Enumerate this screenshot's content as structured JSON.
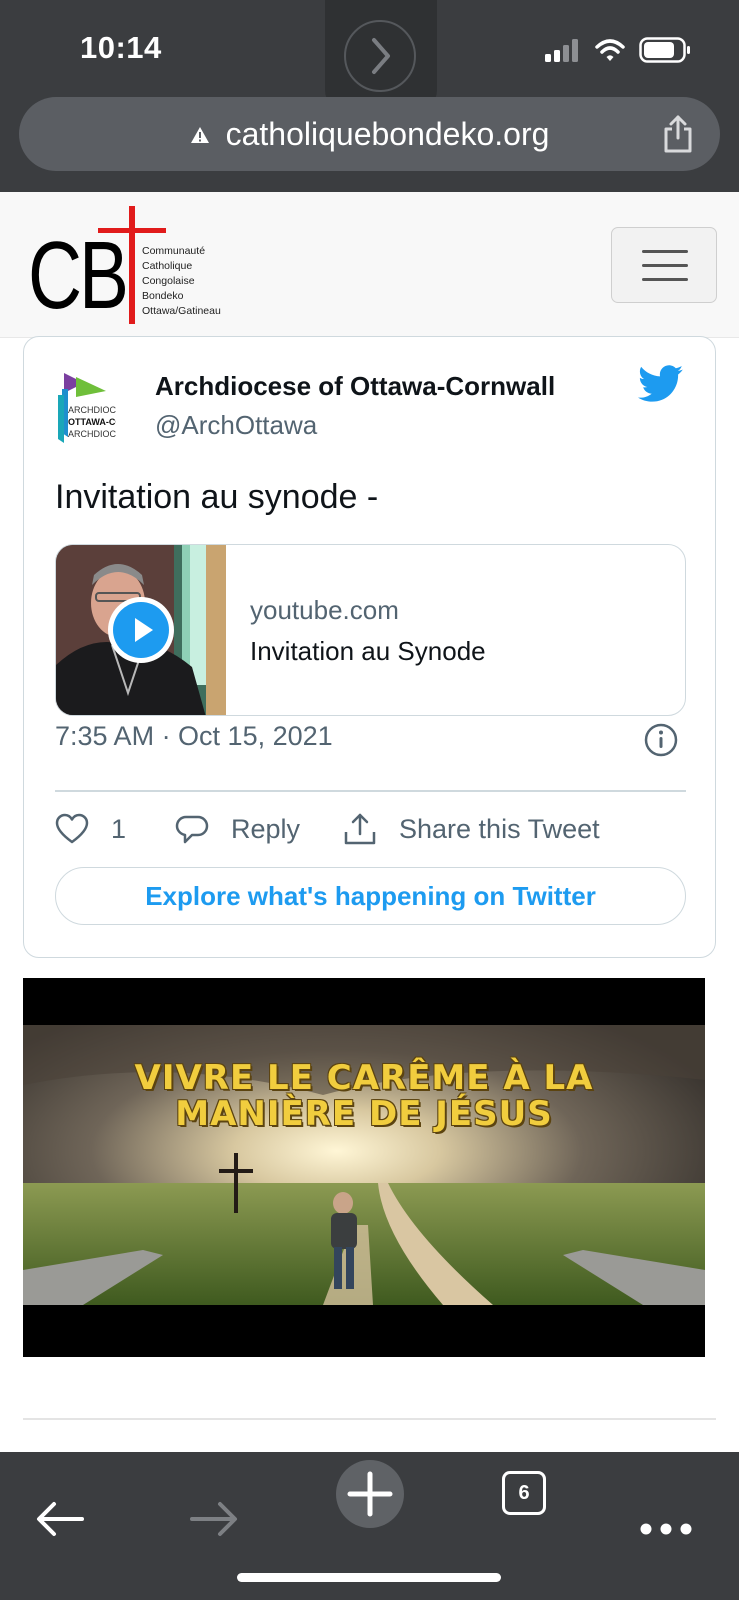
{
  "status_bar": {
    "time": "10:14",
    "icons": [
      "signal-icon",
      "wifi-icon",
      "battery-icon"
    ]
  },
  "browser": {
    "url": "catholiquebondeko.org",
    "security_icon": "warning-icon",
    "open_tab_count": "6",
    "colors": {
      "chrome": "#3b3d40",
      "url_bar": "#5b5e63"
    }
  },
  "site": {
    "logo_letters": "CB",
    "logo_lines": [
      "Communauté",
      "Catholique",
      "Congolaise",
      "Bondeko",
      "Ottawa/Gatineau"
    ],
    "logo_accent": "#e11b1b"
  },
  "tweet": {
    "author_name": "Archdiocese of Ottawa-Cornwall",
    "author_handle": "@ArchOttawa",
    "avatar_lines": [
      "ARCHDIOC",
      "OTTAWA-CO",
      "ARCHDIOC"
    ],
    "text": "Invitation au synode -",
    "link_card": {
      "domain": "youtube.com",
      "title": "Invitation au Synode"
    },
    "timestamp": "7:35 AM · Oct 15, 2021",
    "like_count": "1",
    "reply_label": "Reply",
    "share_label": "Share this Tweet",
    "explore_label": "Explore what's happening on Twitter",
    "colors": {
      "brand": "#1d9bf0",
      "muted": "#536471",
      "border": "#cfd9de"
    }
  },
  "video": {
    "title_line1": "VIVRE LE CARÊME À LA",
    "title_line2": "MANIÈRE DE JÉSUS"
  }
}
